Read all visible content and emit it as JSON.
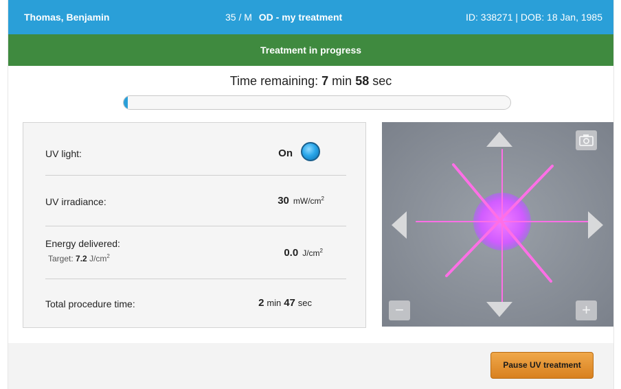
{
  "header": {
    "patient_name": "Thomas, Benjamin",
    "age_sex": "35 / M",
    "treatment_label": "OD - my treatment",
    "id_dob": "ID: 338271 | DOB: 18 Jan, 1985"
  },
  "status": {
    "text": "Treatment in progress"
  },
  "timer": {
    "prefix": "Time remaining:",
    "minutes": "7",
    "min_label": "min",
    "seconds": "58",
    "sec_label": "sec",
    "progress_fraction": 0.01
  },
  "panel": {
    "uv_light_label": "UV light:",
    "uv_light_value": "On",
    "irradiance_label": "UV irradiance:",
    "irradiance_value": "30",
    "irradiance_unit": "mW/cm",
    "energy_label": "Energy delivered:",
    "energy_target_label": "Target:",
    "energy_target_value": "7.2",
    "energy_target_unit": "J/cm",
    "energy_value": "0.0",
    "energy_unit": "J/cm",
    "procedure_label": "Total procedure time:",
    "procedure_min": "2",
    "procedure_min_label": "min",
    "procedure_sec": "47",
    "procedure_sec_label": "sec",
    "unit_exponent": "2"
  },
  "camera": {
    "zoom_out_symbol": "−",
    "zoom_in_symbol": "+"
  },
  "footer": {
    "pause_label": "Pause UV treatment"
  },
  "colors": {
    "header_blue": "#2a9fd8",
    "status_green": "#3f8a3f",
    "pause_orange": "#e0922f",
    "laser_pink": "#ff5ce0",
    "uv_spot": "#d65cff"
  }
}
